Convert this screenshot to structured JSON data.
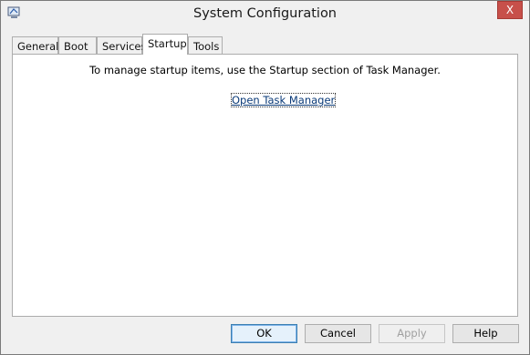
{
  "window": {
    "title": "System Configuration",
    "close_symbol": "X"
  },
  "tabs": [
    {
      "label": "General"
    },
    {
      "label": "Boot"
    },
    {
      "label": "Services"
    },
    {
      "label": "Startup"
    },
    {
      "label": "Tools"
    }
  ],
  "active_tab": "Startup",
  "panel": {
    "message": "To manage startup items, use the Startup section of Task Manager.",
    "link": "Open Task Manager"
  },
  "buttons": {
    "ok": "OK",
    "cancel": "Cancel",
    "apply": "Apply",
    "help": "Help"
  },
  "colors": {
    "close_button": "#c7504a",
    "link": "#0a3a78"
  }
}
